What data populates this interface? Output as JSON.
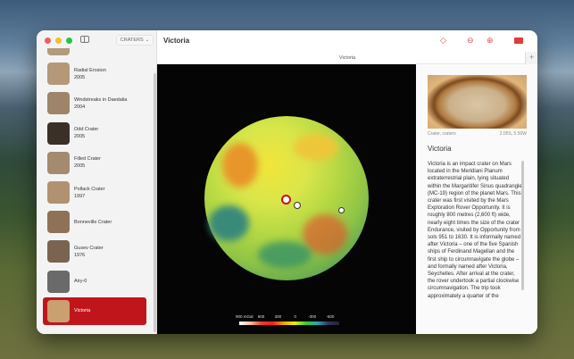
{
  "window": {
    "title": "Victoria",
    "filter_label": "CRATERS"
  },
  "sidebar": {
    "items": [
      {
        "title": "",
        "year": "2005",
        "thumb": "#b49a7c"
      },
      {
        "title": "Radial Erosion",
        "year": "2005",
        "thumb": "#b49878"
      },
      {
        "title": "Windstreaks in Daedalia",
        "year": "2004",
        "thumb": "#9e8468"
      },
      {
        "title": "Odd Crater",
        "year": "2005",
        "thumb": "#3a3028"
      },
      {
        "title": "Filled Crater",
        "year": "2005",
        "thumb": "#a48a6e"
      },
      {
        "title": "Pollack Crater",
        "year": "1997",
        "thumb": "#b09272"
      },
      {
        "title": "Bonneville Crater",
        "year": "",
        "thumb": "#8e7258"
      },
      {
        "title": "Gusev Crater",
        "year": "1976",
        "thumb": "#7a6450"
      },
      {
        "title": "Airy-0",
        "year": "",
        "thumb": "#6a6a6a"
      },
      {
        "title": "Victoria",
        "year": "",
        "thumb": "#c9a070"
      }
    ],
    "selected_index": 9
  },
  "tab": {
    "label": "Victoria"
  },
  "map": {
    "legend_unit": "900 mGal",
    "legend_ticks": [
      "600",
      "300",
      "0",
      "-300",
      "-600"
    ]
  },
  "detail": {
    "caption_left": "Crater, craters",
    "caption_right": "2.05S, 5.50W",
    "title": "Victoria",
    "description": "Victoria is an impact crater on Mars located in the Meridiani Planum extraterrestrial plain, lying situated within the Margaritifer Sinus quadrangle (MC-19) region of the planet Mars. This crater was first visited by the Mars Exploration Rover Opportunity. It is roughly 800 metres (2,600 ft) wide, nearly eight times the size of the crater Endurance, visited by Opportunity from sols 951 to 1630. It is informally named after Victoria – one of the five Spanish ships of Ferdinand Magellan and the first ship to circumnavigate the globe – and formally named after Victoria, Seychelles. After arrival at the crater, the rover undertook a partial clockwise circumnavigation. The trip took approximately a quarter of the"
  }
}
